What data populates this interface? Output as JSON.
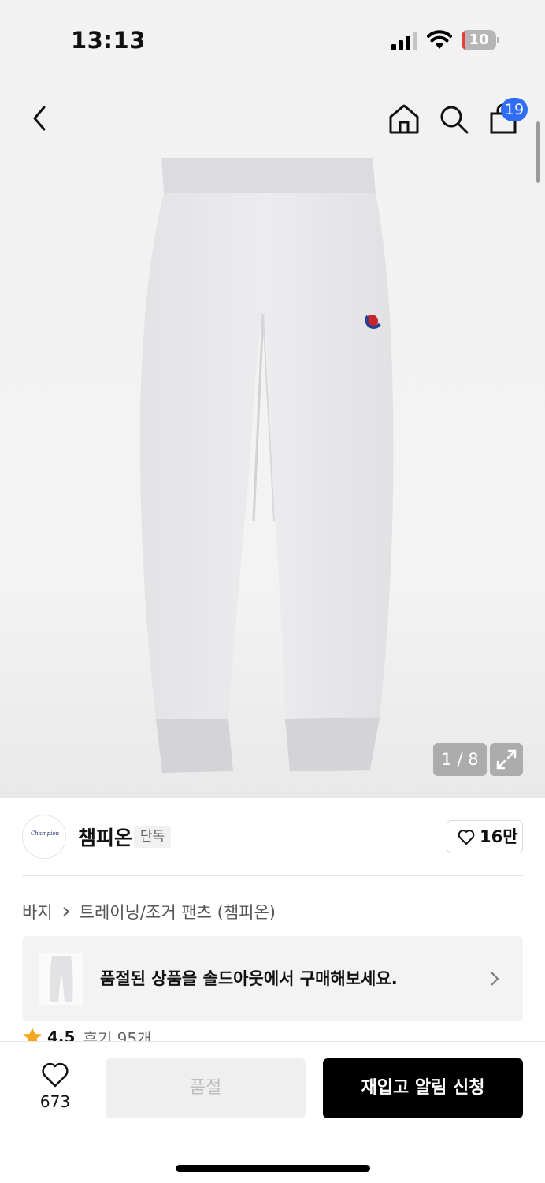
{
  "status_bar": {
    "time": "13:13",
    "battery_level": "10",
    "battery_fraction": 0.1,
    "battery_color": "#e8413c",
    "icons": [
      "signal-icon",
      "wifi-icon",
      "battery-icon"
    ]
  },
  "header": {
    "icons": [
      "back-arrow-icon",
      "home-icon",
      "search-icon",
      "shopping-bag-icon"
    ],
    "cart_count": "19",
    "badge_color": "#2f6df6"
  },
  "gallery": {
    "image": "light gray champion jogger pants",
    "pager": "1 / 8",
    "expand_icon": "expand-icon"
  },
  "brand": {
    "logo_text": "Champion",
    "name": "챔피온",
    "tag": "단독",
    "likes": "16만"
  },
  "breadcrumb": {
    "items": [
      "바지",
      "트레이닝/조거 팬츠 (챔피온)"
    ]
  },
  "soldout_banner": {
    "text": "품절된 상품을 솔드아웃에서 구매해보세요."
  },
  "rating": {
    "score": "4.5",
    "reviews": "후기 95개",
    "star_color": "#f5a623"
  },
  "bottom_bar": {
    "wish_count": "673",
    "soldout_label": "품절",
    "restock_label": "재입고 알림 신청"
  }
}
